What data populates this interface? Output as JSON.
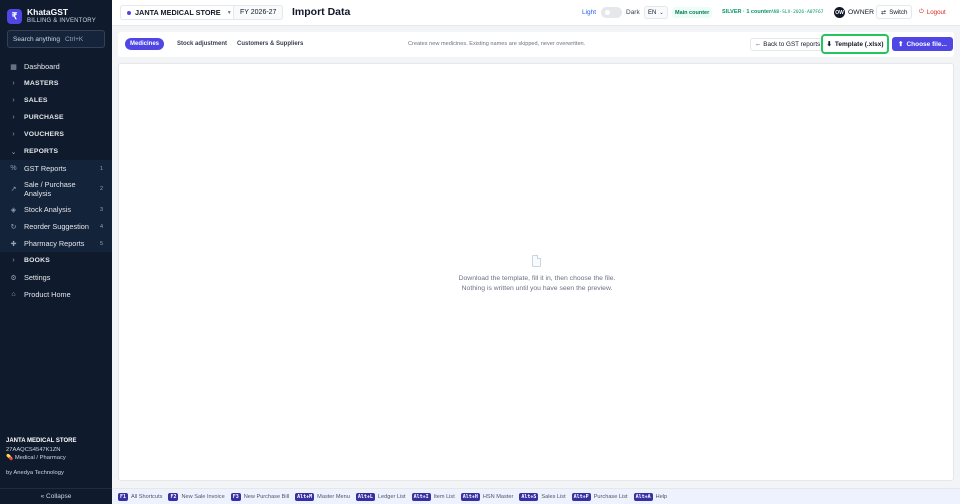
{
  "brand": {
    "name": "KhataGST",
    "subtitle": "BILLING & INVENTORY",
    "logo_glyph": "₹"
  },
  "sidebar": {
    "search_placeholder": "Search anything",
    "search_shortcut": "Ctrl+K",
    "items": [
      {
        "label": "Dashboard",
        "icon": "grid-icon",
        "glyph": "▦"
      },
      {
        "label": "MASTERS",
        "group": true
      },
      {
        "label": "SALES",
        "group": true
      },
      {
        "label": "PURCHASE",
        "group": true
      },
      {
        "label": "VOUCHERS",
        "group": true
      },
      {
        "label": "REPORTS",
        "group": true,
        "expanded": true
      },
      {
        "label": "GST Reports",
        "icon": "percent-icon",
        "glyph": "%",
        "badge": "1"
      },
      {
        "label": "Sale / Purchase Analysis",
        "icon": "trend-icon",
        "glyph": "↗",
        "badge": "2"
      },
      {
        "label": "Stock Analysis",
        "icon": "box-icon",
        "glyph": "◈",
        "badge": "3"
      },
      {
        "label": "Reorder Suggestion",
        "icon": "refresh-icon",
        "glyph": "↻",
        "badge": "4"
      },
      {
        "label": "Pharmacy Reports",
        "icon": "pill-icon",
        "glyph": "✚",
        "badge": "5"
      },
      {
        "label": "BOOKS",
        "group": true
      },
      {
        "label": "Settings",
        "icon": "gear-icon",
        "glyph": "⚙"
      },
      {
        "label": "Product Home",
        "icon": "home-icon",
        "glyph": "⌂"
      }
    ],
    "store_name": "JANTA MEDICAL STORE",
    "gstin": "27AAQCS4547K1ZN",
    "store_type": "Medical / Pharmacy",
    "by_line": "by Anedya Technology",
    "collapse_label": "« Collapse"
  },
  "topbar": {
    "store": "JANTA MEDICAL STORE",
    "fy": "FY 2026-27",
    "title": "Import Data",
    "light_label": "Light",
    "dark_label": "Dark",
    "lang": "EN",
    "counter_badge": "Main counter",
    "plan": "SILVER · 1 counter",
    "license_key": "ANB-SLV-2026-A07F67",
    "avatar_initials": "OW",
    "role": "OWNER",
    "switch_label": "Switch",
    "logout_label": "Logout"
  },
  "toolbar": {
    "tabs": [
      "Medicines",
      "Stock adjustment",
      "Customers & Suppliers"
    ],
    "active_tab": 0,
    "hint": "Creates new medicines. Existing names are skipped, never overwritten.",
    "back_label": "Back to GST reports",
    "template_label": "Template (.xlsx)",
    "choose_label": "Choose file..."
  },
  "empty_state": {
    "line1": "Download the template, fill it in, then choose the file.",
    "line2": "Nothing is written until you have seen the preview."
  },
  "shortcuts": [
    {
      "key": "F1",
      "label": "All Shortcuts"
    },
    {
      "key": "F2",
      "label": "New Sale Invoice"
    },
    {
      "key": "F3",
      "label": "New Purchase Bill"
    },
    {
      "key": "Alt+M",
      "label": "Master Menu"
    },
    {
      "key": "Alt+L",
      "label": "Ledger List"
    },
    {
      "key": "Alt+I",
      "label": "Item List"
    },
    {
      "key": "Alt+H",
      "label": "HSN Master"
    },
    {
      "key": "Alt+S",
      "label": "Sales List"
    },
    {
      "key": "Alt+P",
      "label": "Purchase List"
    },
    {
      "key": "Alt+A",
      "label": "Help"
    }
  ],
  "colors": {
    "sidebar_bg": "#0f1b2d",
    "accent": "#4f46e5",
    "highlight": "#22c55e",
    "logout": "#dc2626"
  }
}
